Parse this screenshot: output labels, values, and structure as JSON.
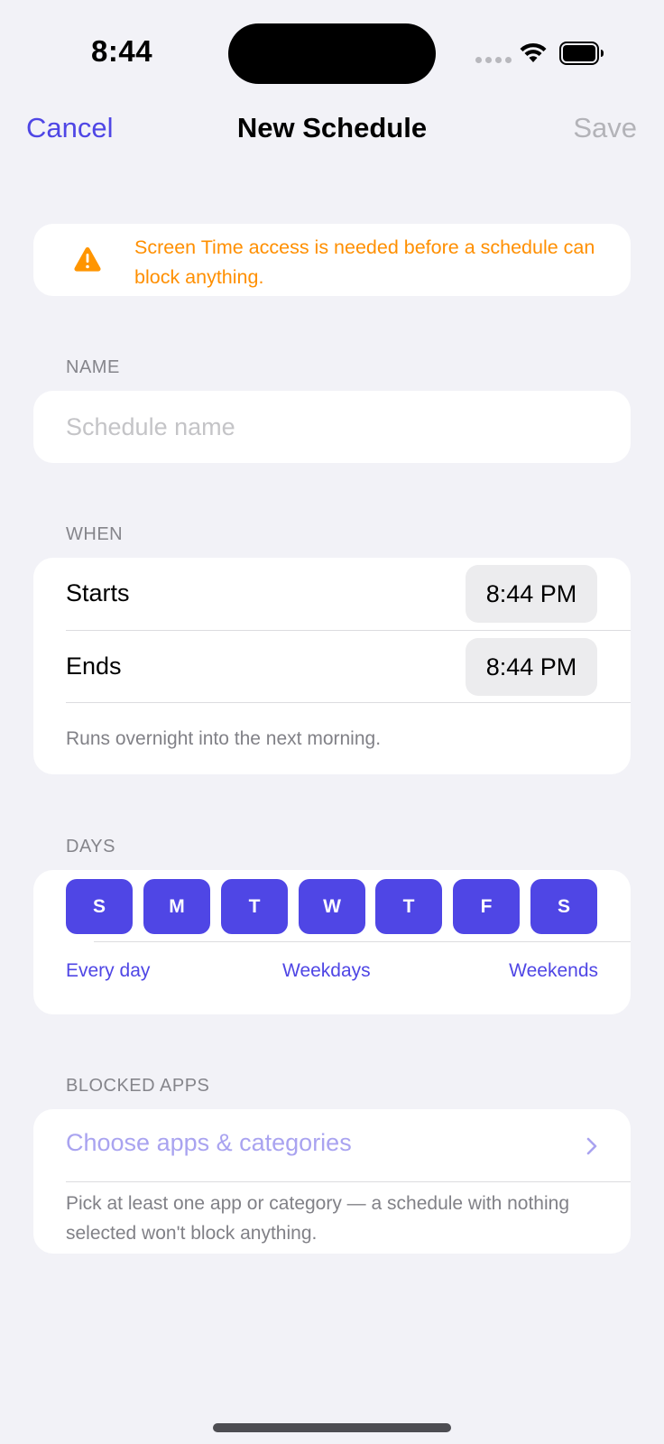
{
  "status_bar": {
    "time": "8:44"
  },
  "nav": {
    "cancel": "Cancel",
    "title": "New Schedule",
    "save": "Save"
  },
  "warning": {
    "icon": "warning-triangle-icon",
    "text": "Screen Time access is needed before a schedule can block anything."
  },
  "name_section": {
    "header": "NAME",
    "placeholder": "Schedule name",
    "value": ""
  },
  "when_section": {
    "header": "WHEN",
    "starts_label": "Starts",
    "starts_time": "8:44 PM",
    "ends_label": "Ends",
    "ends_time": "8:44 PM",
    "note": "Runs overnight into the next morning."
  },
  "days_section": {
    "header": "DAYS",
    "days": [
      "S",
      "M",
      "T",
      "W",
      "T",
      "F",
      "S"
    ],
    "presets": [
      "Every day",
      "Weekdays",
      "Weekends"
    ]
  },
  "apps_section": {
    "header": "BLOCKED APPS",
    "choose_label": "Choose apps & categories",
    "note": "Pick at least one app or category — a schedule with nothing selected won't block anything."
  },
  "colors": {
    "accent": "#4f46e5",
    "warning": "#ff8f00",
    "background": "#f2f2f7"
  }
}
